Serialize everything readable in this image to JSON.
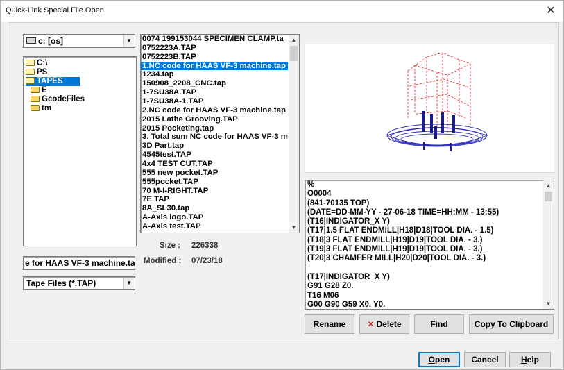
{
  "window": {
    "title": "Quick-Link Special File Open",
    "close_glyph": "✕"
  },
  "drive_combo": {
    "value": "c: [os]"
  },
  "tree": {
    "items": [
      "C:\\",
      "PS",
      "TAPES",
      "E",
      "GcodeFiles",
      "tm"
    ],
    "selected": "TAPES"
  },
  "filelist": {
    "items": [
      "0074 199153044 SPECIMEN CLAMP.ta",
      "0752223A.TAP",
      "0752223B.TAP",
      "1.NC code for HAAS VF-3 machine.tap",
      "1234.tap",
      "150908_2208_CNC.tap",
      "1-7SU38A.TAP",
      "1-7SU38A-1.TAP",
      "2.NC code for HAAS VF-3 machine.tap",
      "2015 Lathe Grooving.TAP",
      "2015 Pocketing.tap",
      "3. Total sum NC code for HAAS VF-3 m",
      "3D Part.tap",
      "4545test.TAP",
      "4x4 TEST CUT.TAP",
      "555 new pocket.TAP",
      "555pocket.TAP",
      "70 M-I-RIGHT.TAP",
      "7E.TAP",
      "8A_SL30.tap",
      "A-Axis logo.TAP",
      "A-Axis test.TAP"
    ],
    "selected_index": 3
  },
  "file_info": {
    "size_label": "Size :",
    "size_value": "226338",
    "modified_label": "Modified :",
    "modified_value": "07/23/18"
  },
  "filename_field": {
    "value": "e for HAAS VF-3 machine.tap"
  },
  "filetype_combo": {
    "value": "Tape Files (*.TAP)"
  },
  "nc_text": {
    "lines": [
      "%",
      "O0004",
      "(841-70135 TOP)",
      "(DATE=DD-MM-YY - 27-06-18 TIME=HH:MM - 13:55)",
      "(T16|INDIGATOR_X Y)",
      "(T17|1.5 FLAT ENDMILL|H18|D18|TOOL DIA. - 1.5)",
      "(T18|3 FLAT ENDMILL|H19|D19|TOOL DIA. - 3.)",
      "(T19|3 FLAT ENDMILL|H19|D19|TOOL DIA. - 3.)",
      "(T20|3 CHAMFER MILL|H20|D20|TOOL DIA. - 3.)",
      "",
      "(T17|INDIGATOR_X Y)",
      "G91 G28 Z0.",
      "T16 M06",
      "G00 G90 G59 X0. Y0."
    ]
  },
  "buttons": {
    "rename": "Rename",
    "delete": "Delete",
    "delete_icon": "✕",
    "find": "Find",
    "copy": "Copy To Clipboard",
    "open": "Open",
    "cancel": "Cancel",
    "help": "Help"
  }
}
